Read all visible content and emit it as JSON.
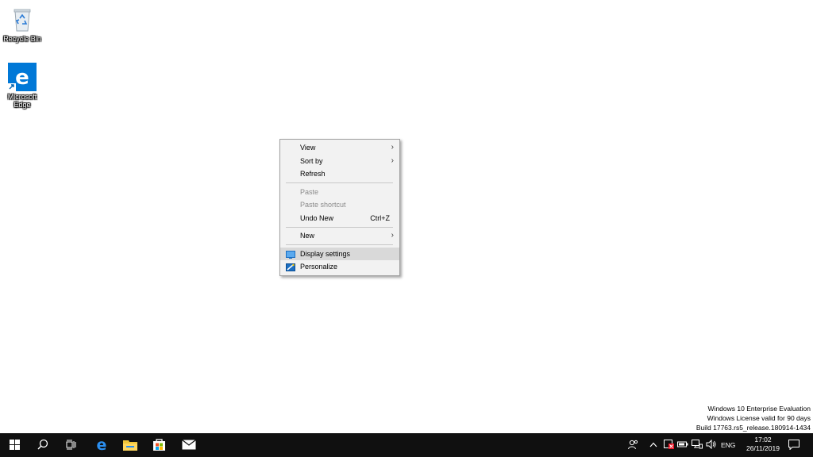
{
  "desktop": {
    "icons": [
      {
        "label": "Recycle Bin"
      },
      {
        "label": "Microsoft Edge"
      }
    ]
  },
  "context_menu": {
    "items": {
      "view": "View",
      "sort_by": "Sort by",
      "refresh": "Refresh",
      "paste": "Paste",
      "paste_shortcut": "Paste shortcut",
      "undo_new": "Undo New",
      "undo_new_shortcut": "Ctrl+Z",
      "new": "New",
      "display_settings": "Display settings",
      "personalize": "Personalize"
    }
  },
  "watermark": {
    "line1": "Windows 10 Enterprise Evaluation",
    "line2": "Windows License valid for 90 days",
    "line3": "Build 17763.rs5_release.180914-1434"
  },
  "taskbar": {
    "icons": [
      "windows-start-icon",
      "search-icon",
      "task-view-icon",
      "edge-icon",
      "file-explorer-icon",
      "store-icon",
      "mail-icon"
    ],
    "tray": {
      "language": "ENG",
      "time": "17:02",
      "date": "26/11/2019"
    }
  },
  "colors": {
    "taskbar": "#101010",
    "accent": "#0078d7",
    "menu_bg": "#f2f2f2",
    "menu_hover": "#d9d9d9"
  }
}
